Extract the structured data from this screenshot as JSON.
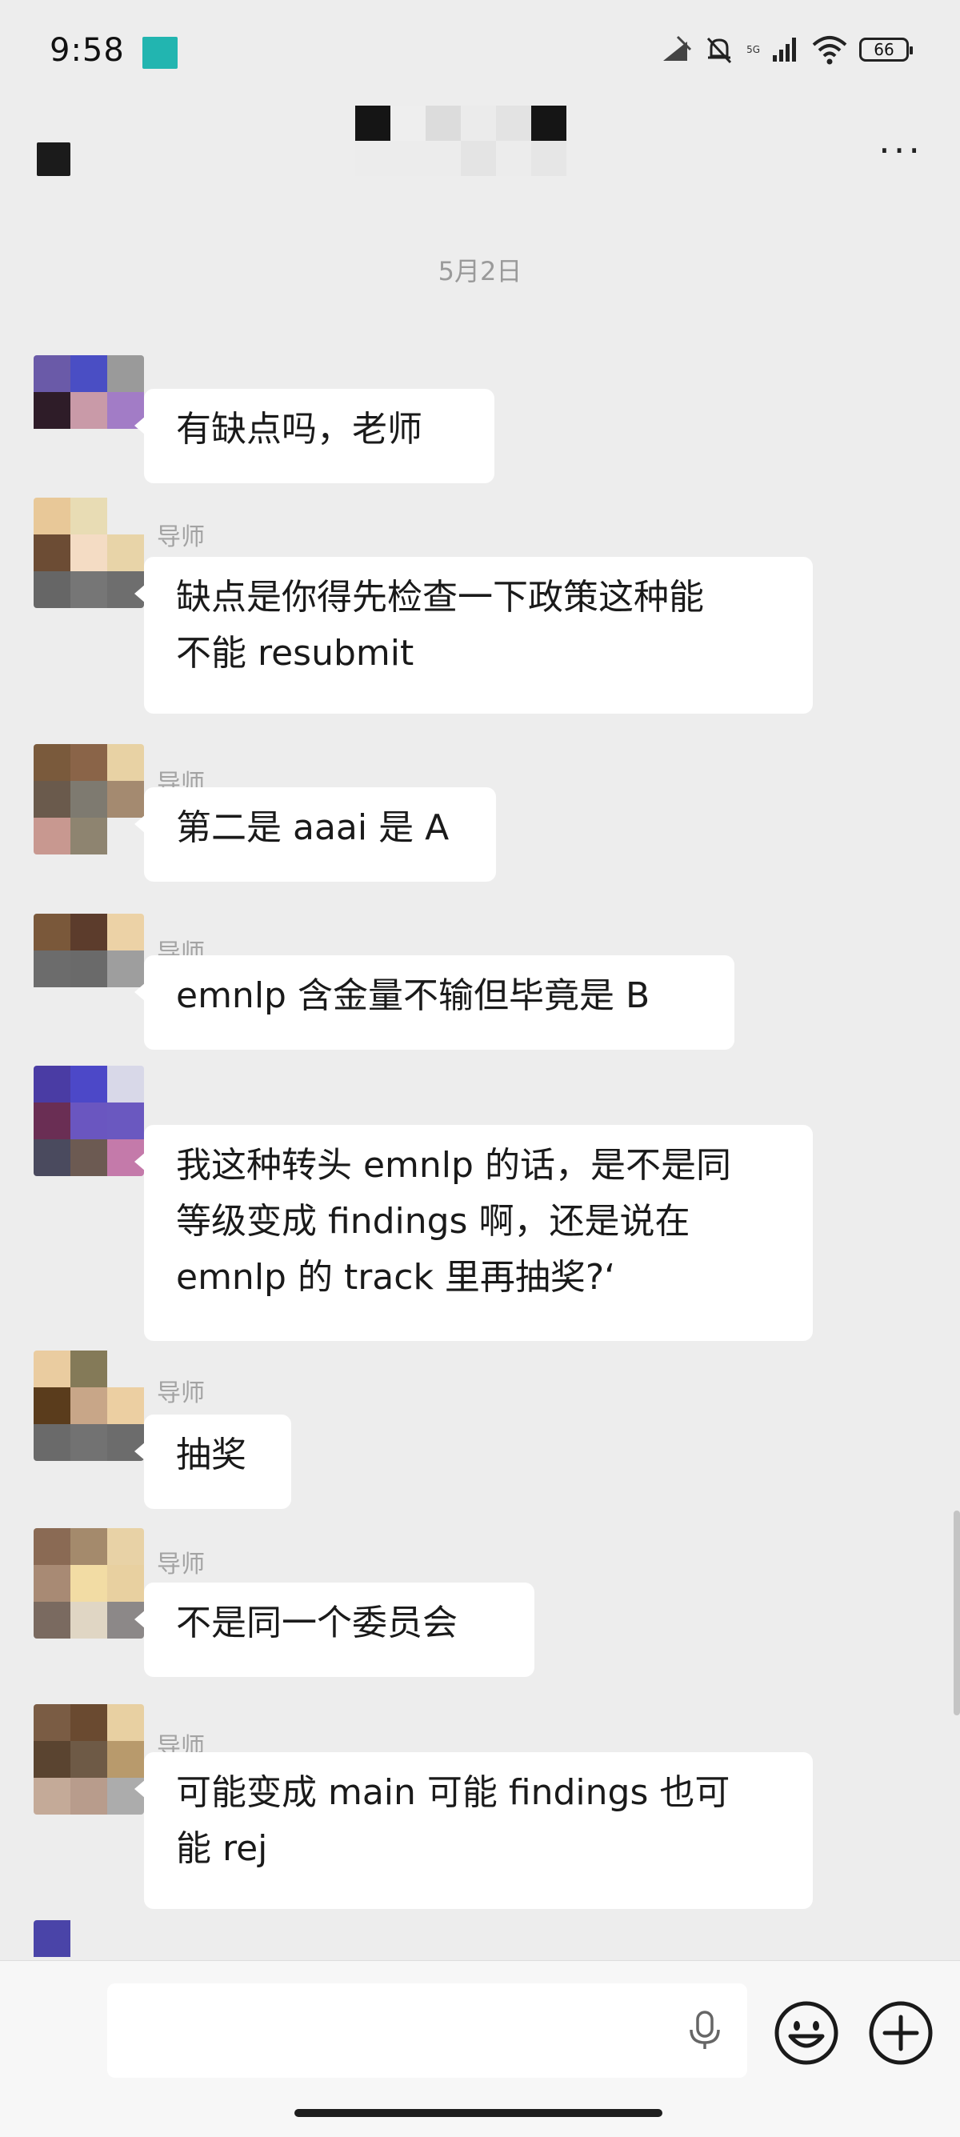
{
  "status_bar": {
    "time": "9:58",
    "battery": "66",
    "network": "5G"
  },
  "header": {
    "back_icon": "back-icon",
    "more_icon": "more-dots-icon",
    "more_label": "···"
  },
  "chat": {
    "date_separator": "5月2日",
    "messages": [
      {
        "sender": "",
        "text": "有缺点吗，老师"
      },
      {
        "sender": "导师",
        "text": "缺点是你得先检查一下政策这种能\n不能 resubmit"
      },
      {
        "sender": "导师",
        "text": "第二是 aaai 是 A"
      },
      {
        "sender": "导师",
        "text": "emnlp 含金量不输但毕竟是 B"
      },
      {
        "sender": "",
        "text": "我这种转头 emnlp 的话，是不是同\n等级变成 findings 啊，还是说在\nemnlp 的 track 里再抽奖?‘"
      },
      {
        "sender": "导师",
        "text": "抽奖"
      },
      {
        "sender": "导师",
        "text": "不是同一个委员会"
      },
      {
        "sender": "导师",
        "text": "可能变成 main 可能 findings 也可\n能 rej"
      }
    ]
  },
  "input_bar": {
    "placeholder": "",
    "mic_icon": "mic-icon",
    "emoji_icon": "emoji-icon",
    "plus_icon": "plus-icon"
  },
  "colors": {
    "background": "#ededed",
    "bubble": "#ffffff",
    "sender_name": "#a3a3a3",
    "input_bar": "#f7f7f7"
  }
}
